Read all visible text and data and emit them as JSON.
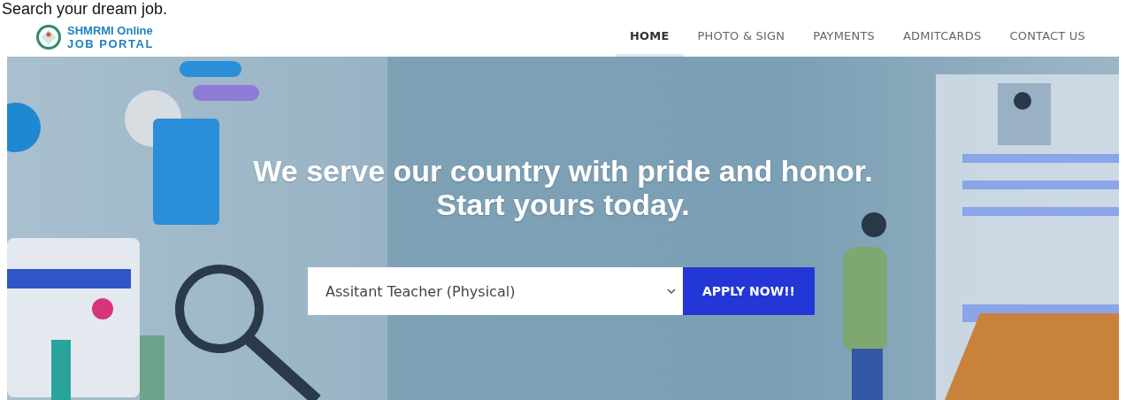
{
  "caption": "Search your dream job.",
  "logo": {
    "line1": "SHMRMI Online",
    "line2": "JOB PORTAL"
  },
  "nav": [
    {
      "label": "HOME",
      "selected": true
    },
    {
      "label": "PHOTO & SIGN",
      "selected": false
    },
    {
      "label": "PAYMENTS",
      "selected": false
    },
    {
      "label": "ADMITCARDS",
      "selected": false
    },
    {
      "label": "CONTACT US",
      "selected": false
    }
  ],
  "hero": {
    "headline": [
      "We serve our country with pride and honor.",
      "Start yours today."
    ],
    "job_select": {
      "value": "Assitant Teacher (Physical)"
    },
    "apply_button": "APPLY NOW!!"
  }
}
